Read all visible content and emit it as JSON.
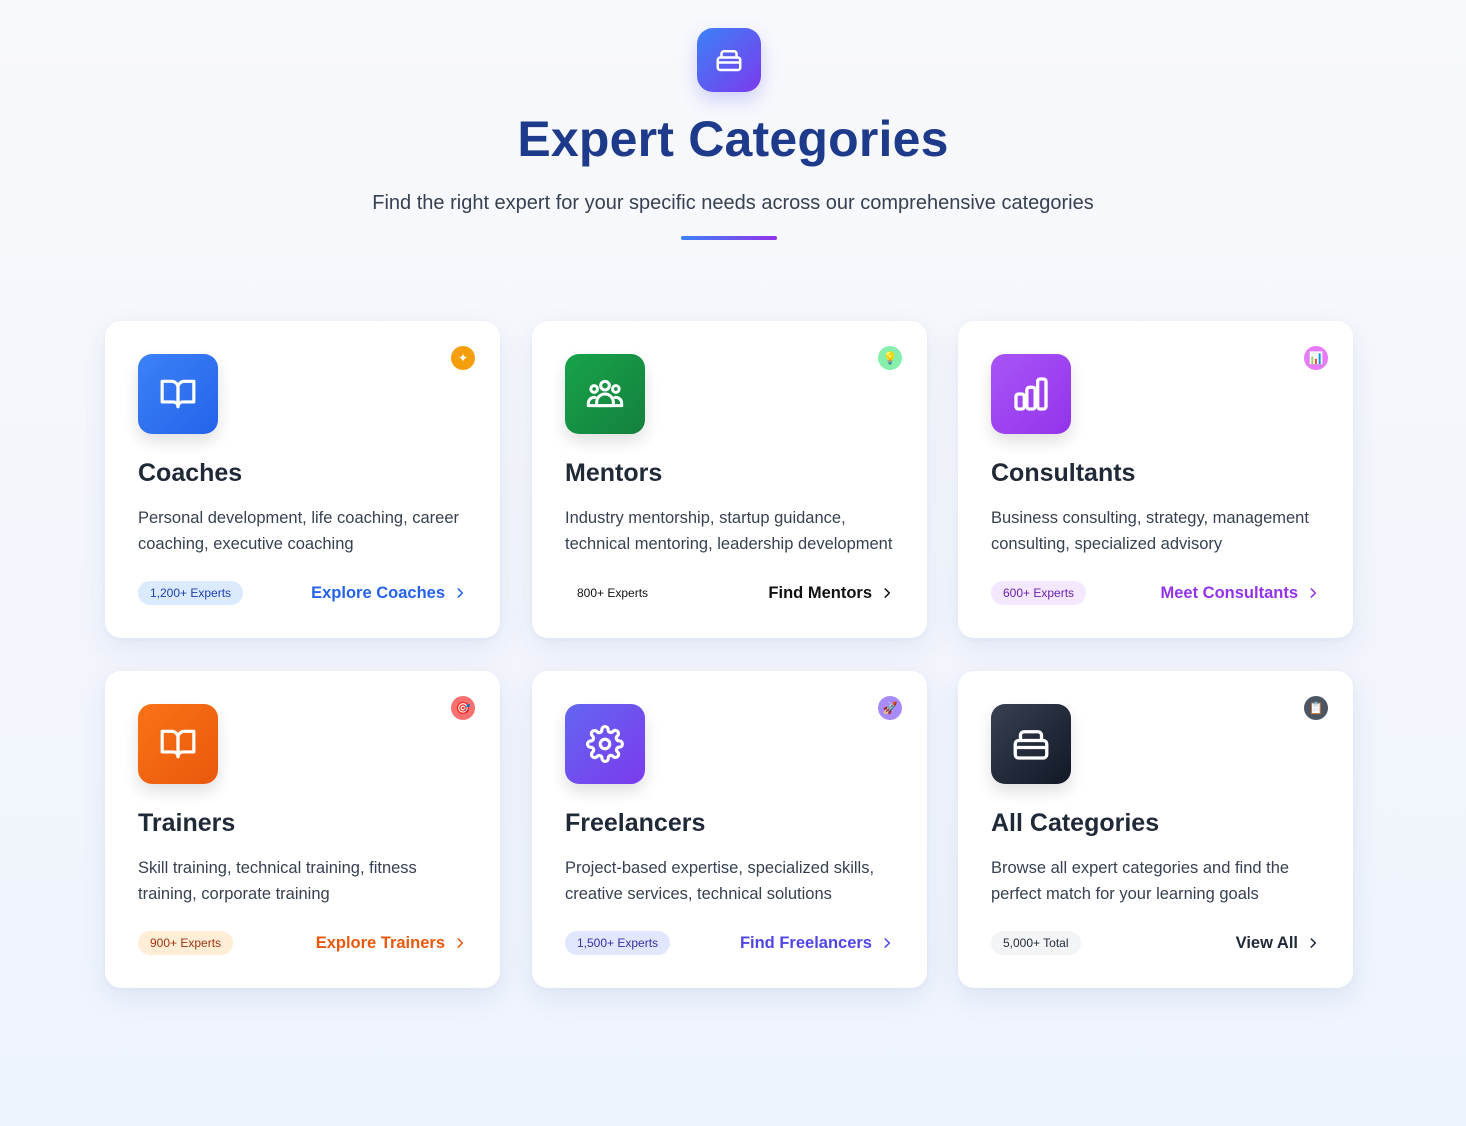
{
  "header": {
    "icon": "briefcase-icon",
    "title": "Expert Categories",
    "subtitle": "Find the right expert for your specific needs across our comprehensive categories"
  },
  "cards": [
    {
      "id": "coaches",
      "icon": "book-open-icon",
      "badge_icon": "sparkle-icon",
      "badge_glyph": "✦",
      "title": "Coaches",
      "description": "Personal development, life coaching, career coaching, executive coaching",
      "count": "1,200+ Experts",
      "cta": "Explore Coaches",
      "accent": "#2563eb",
      "icon_gradient": [
        "#3b82f6",
        "#2563eb"
      ],
      "count_bg": "#dbeafe",
      "count_color": "#1e40af",
      "badge_bg": "#f59e0b"
    },
    {
      "id": "mentors",
      "icon": "users-group-icon",
      "badge_icon": "lightbulb-icon",
      "badge_glyph": "💡",
      "title": "Mentors",
      "description": "Industry mentorship, startup guidance, technical mentoring, leadership development",
      "count": "800+ Experts",
      "cta": "Find Mentors",
      "accent": "#111111",
      "icon_gradient": [
        "#16a34a",
        "#15803d"
      ],
      "count_bg": "#ffffff",
      "count_color": "#111111",
      "badge_bg": "#86efac"
    },
    {
      "id": "consultants",
      "icon": "bar-chart-icon",
      "badge_icon": "chart-emoji-icon",
      "badge_glyph": "📊",
      "title": "Consultants",
      "description": "Business consulting, strategy, management consulting, specialized advisory",
      "count": "600+ Experts",
      "cta": "Meet Consultants",
      "accent": "#9333ea",
      "icon_gradient": [
        "#a855f7",
        "#9333ea"
      ],
      "count_bg": "#f3e8ff",
      "count_color": "#6b21a8",
      "badge_bg": "#e879f9"
    },
    {
      "id": "trainers",
      "icon": "book-open-icon",
      "badge_icon": "target-icon",
      "badge_glyph": "🎯",
      "title": "Trainers",
      "description": "Skill training, technical training, fitness training, corporate training",
      "count": "900+ Experts",
      "cta": "Explore Trainers",
      "accent": "#ea580c",
      "icon_gradient": [
        "#f97316",
        "#ea580c"
      ],
      "count_bg": "#ffedd5",
      "count_color": "#9a3412",
      "badge_bg": "#f87171"
    },
    {
      "id": "freelancers",
      "icon": "gear-icon",
      "badge_icon": "rocket-icon",
      "badge_glyph": "🚀",
      "title": "Freelancers",
      "description": "Project-based expertise, specialized skills, creative services, technical solutions",
      "count": "1,500+ Experts",
      "cta": "Find Freelancers",
      "accent": "#4f46e5",
      "icon_gradient": [
        "#6366f1",
        "#7c3aed"
      ],
      "count_bg": "#e0e7ff",
      "count_color": "#3730a3",
      "badge_bg": "#a78bfa"
    },
    {
      "id": "all-categories",
      "icon": "briefcase-icon",
      "badge_icon": "clipboard-icon",
      "badge_glyph": "📋",
      "title": "All Categories",
      "description": "Browse all expert categories and find the perfect match for your learning goals",
      "count": "5,000+ Total",
      "cta": "View All",
      "accent": "#1f2937",
      "icon_gradient": [
        "#374151",
        "#111827"
      ],
      "count_bg": "#f3f4f6",
      "count_color": "#1f2937",
      "badge_bg": "#4b5563"
    }
  ]
}
